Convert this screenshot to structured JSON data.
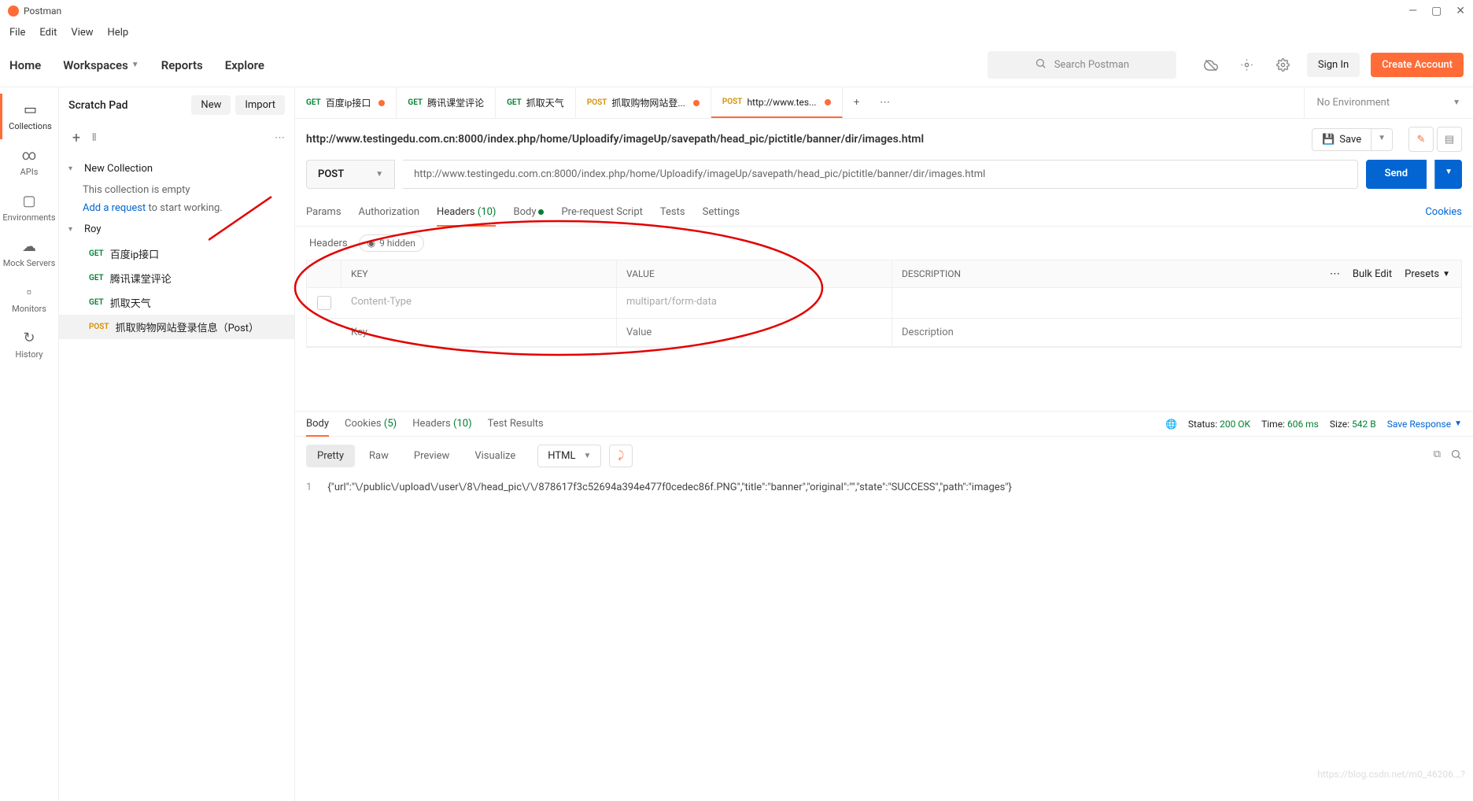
{
  "app": {
    "title": "Postman"
  },
  "menu": [
    "File",
    "Edit",
    "View",
    "Help"
  ],
  "topnav": {
    "items": [
      "Home",
      "Workspaces",
      "Reports",
      "Explore"
    ],
    "search_placeholder": "Search Postman",
    "signin": "Sign In",
    "create": "Create Account"
  },
  "sidebar": {
    "title": "Scratch Pad",
    "new": "New",
    "import": "Import",
    "iconbar": [
      "Collections",
      "APIs",
      "Environments",
      "Mock Servers",
      "Monitors",
      "History"
    ],
    "collections": {
      "new_collection": "New Collection",
      "empty_msg": "This collection is empty",
      "add_link": "Add a request",
      "add_suffix": " to start working.",
      "roy": "Roy",
      "requests": [
        {
          "method": "GET",
          "name": "百度ip接口"
        },
        {
          "method": "GET",
          "name": "腾讯课堂评论"
        },
        {
          "method": "GET",
          "name": "抓取天气"
        },
        {
          "method": "POST",
          "name": "抓取购物网站登录信息（Post）"
        }
      ]
    }
  },
  "tabs": [
    {
      "method": "GET",
      "label": "百度ip接口",
      "unsaved": true
    },
    {
      "method": "GET",
      "label": "腾讯课堂评论"
    },
    {
      "method": "GET",
      "label": "抓取天气"
    },
    {
      "method": "POST",
      "label": "抓取购物网站登...",
      "unsaved": true
    },
    {
      "method": "POST",
      "label": "http://www.tes...",
      "unsaved": true,
      "active": true
    }
  ],
  "env": {
    "none": "No Environment"
  },
  "request": {
    "url_display": "http://www.testingedu.com.cn:8000/index.php/home/Uploadify/imageUp/savepath/head_pic/pictitle/banner/dir/images.html",
    "save": "Save",
    "method": "POST",
    "url": "http://www.testingedu.com.cn:8000/index.php/home/Uploadify/imageUp/savepath/head_pic/pictitle/banner/dir/images.html",
    "send": "Send",
    "tabs": {
      "params": "Params",
      "auth": "Authorization",
      "headers": "Headers",
      "headers_count": "(10)",
      "body": "Body",
      "prereq": "Pre-request Script",
      "tests": "Tests",
      "settings": "Settings",
      "cookies": "Cookies"
    }
  },
  "headers": {
    "title": "Headers",
    "hidden": "9 hidden",
    "columns": {
      "key": "KEY",
      "value": "VALUE",
      "desc": "DESCRIPTION",
      "bulk": "Bulk Edit",
      "presets": "Presets"
    },
    "rows": [
      {
        "key": "Content-Type",
        "value": "multipart/form-data"
      }
    ],
    "placeholders": {
      "key": "Key",
      "value": "Value",
      "desc": "Description"
    }
  },
  "response": {
    "tabs": {
      "body": "Body",
      "cookies": "Cookies",
      "cookies_count": "(5)",
      "headers": "Headers",
      "headers_count": "(10)",
      "tests": "Test Results"
    },
    "status_label": "Status:",
    "status": "200 OK",
    "time_label": "Time:",
    "time": "606 ms",
    "size_label": "Size:",
    "size": "542 B",
    "save": "Save Response",
    "views": {
      "pretty": "Pretty",
      "raw": "Raw",
      "preview": "Preview",
      "visualize": "Visualize"
    },
    "format": "HTML",
    "body_text": "{\"url\":\"\\/public\\/upload\\/user\\/8\\/head_pic\\/\\/878617f3c52694a394e477f0cedec86f.PNG\",\"title\":\"banner\",\"original\":\"\",\"state\":\"SUCCESS\",\"path\":\"images\"}"
  },
  "watermark": "https://blog.csdn.net/m0_46206...?"
}
